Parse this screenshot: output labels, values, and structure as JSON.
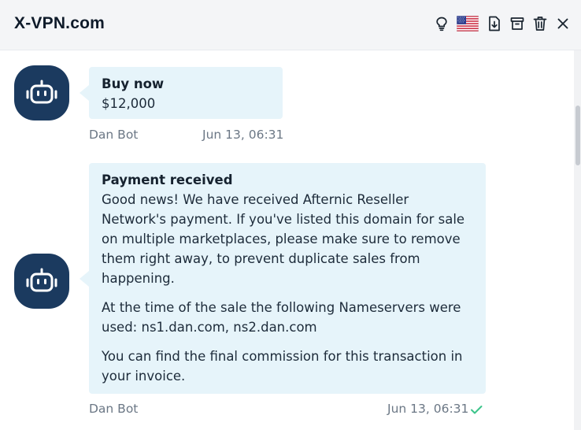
{
  "header": {
    "title": "X-VPN.com",
    "icons": [
      "lightbulb-icon",
      "us-flag-icon",
      "download-icon",
      "archive-icon",
      "trash-icon",
      "close-icon"
    ]
  },
  "messages": [
    {
      "title": "Buy now",
      "body": [
        "$12,000"
      ],
      "sender": "Dan Bot",
      "time": "Jun 13, 06:31",
      "read": false
    },
    {
      "title": "Payment received",
      "body": [
        "Good news! We have received Afternic Reseller Network's payment. If you've listed this domain for sale on multiple marketplaces, please make sure to remove them right away, to prevent duplicate sales from happening.",
        "At the time of the sale the following Nameservers were used: ns1.dan.com, ns2.dan.com",
        "You can find the final commission for this transaction in your invoice."
      ],
      "sender": "Dan Bot",
      "time": "Jun 13, 06:31",
      "read": true
    }
  ],
  "colors": {
    "avatar_bg": "#1b3a5f",
    "bubble_bg": "#e6f4fa",
    "read_check": "#3cc48a"
  }
}
